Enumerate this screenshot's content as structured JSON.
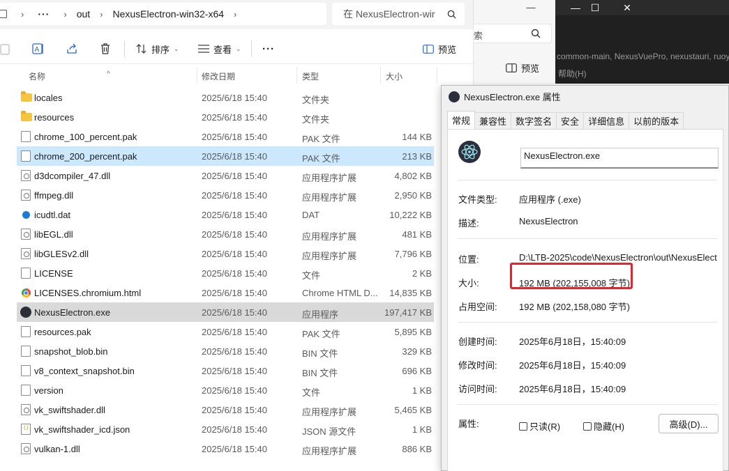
{
  "explorer": {
    "breadcrumb": [
      "out",
      "NexusElectron-win32-x64"
    ],
    "search_placeholder": "在 NexusElectron-wir",
    "toolbar": {
      "sort_label": "排序",
      "view_label": "查看",
      "more_label": "···",
      "preview_label": "预览"
    },
    "columns": {
      "name": "名称",
      "date": "修改日期",
      "type": "类型",
      "size": "大小"
    },
    "files": [
      {
        "name": "locales",
        "date": "2025/6/18 15:40",
        "type": "文件夹",
        "size": "",
        "icon": "folder-icon"
      },
      {
        "name": "resources",
        "date": "2025/6/18 15:40",
        "type": "文件夹",
        "size": "",
        "icon": "folder-icon"
      },
      {
        "name": "chrome_100_percent.pak",
        "date": "2025/6/18 15:40",
        "type": "PAK 文件",
        "size": "144 KB",
        "icon": "file-icon"
      },
      {
        "name": "chrome_200_percent.pak",
        "date": "2025/6/18 15:40",
        "type": "PAK 文件",
        "size": "213 KB",
        "icon": "file-icon"
      },
      {
        "name": "d3dcompiler_47.dll",
        "date": "2025/6/18 15:40",
        "type": "应用程序扩展",
        "size": "4,802 KB",
        "icon": "dll-icon"
      },
      {
        "name": "ffmpeg.dll",
        "date": "2025/6/18 15:40",
        "type": "应用程序扩展",
        "size": "2,950 KB",
        "icon": "dll-icon"
      },
      {
        "name": "icudtl.dat",
        "date": "2025/6/18 15:40",
        "type": "DAT",
        "size": "10,222 KB",
        "icon": "dat-icon"
      },
      {
        "name": "libEGL.dll",
        "date": "2025/6/18 15:40",
        "type": "应用程序扩展",
        "size": "481 KB",
        "icon": "dll-icon"
      },
      {
        "name": "libGLESv2.dll",
        "date": "2025/6/18 15:40",
        "type": "应用程序扩展",
        "size": "7,796 KB",
        "icon": "dll-icon"
      },
      {
        "name": "LICENSE",
        "date": "2025/6/18 15:40",
        "type": "文件",
        "size": "2 KB",
        "icon": "file-icon"
      },
      {
        "name": "LICENSES.chromium.html",
        "date": "2025/6/18 15:40",
        "type": "Chrome HTML D...",
        "size": "14,835 KB",
        "icon": "chrome-icon"
      },
      {
        "name": "NexusElectron.exe",
        "date": "2025/6/18 15:40",
        "type": "应用程序",
        "size": "197,417 KB",
        "icon": "electron-icon"
      },
      {
        "name": "resources.pak",
        "date": "2025/6/18 15:40",
        "type": "PAK 文件",
        "size": "5,895 KB",
        "icon": "file-icon"
      },
      {
        "name": "snapshot_blob.bin",
        "date": "2025/6/18 15:40",
        "type": "BIN 文件",
        "size": "329 KB",
        "icon": "file-icon"
      },
      {
        "name": "v8_context_snapshot.bin",
        "date": "2025/6/18 15:40",
        "type": "BIN 文件",
        "size": "696 KB",
        "icon": "file-icon"
      },
      {
        "name": "version",
        "date": "2025/6/18 15:40",
        "type": "文件",
        "size": "1 KB",
        "icon": "file-icon"
      },
      {
        "name": "vk_swiftshader.dll",
        "date": "2025/6/18 15:40",
        "type": "应用程序扩展",
        "size": "5,465 KB",
        "icon": "dll-icon"
      },
      {
        "name": "vk_swiftshader_icd.json",
        "date": "2025/6/18 15:40",
        "type": "JSON 源文件",
        "size": "1 KB",
        "icon": "json-icon"
      },
      {
        "name": "vulkan-1.dll",
        "date": "2025/6/18 15:40",
        "type": "应用程序扩展",
        "size": "886 KB",
        "icon": "dll-icon"
      }
    ]
  },
  "background": {
    "search_fragment": "索",
    "preview_label": "预览",
    "path_text": "common-main, NexusVuePro, nexustauri, ruoyi",
    "help_text": "帮助(H)"
  },
  "properties": {
    "title": "NexusElectron.exe 属性",
    "tabs": [
      "常规",
      "兼容性",
      "数字签名",
      "安全",
      "详细信息",
      "以前的版本"
    ],
    "filename": "NexusElectron.exe",
    "fields": {
      "type_label": "文件类型:",
      "type_value": "应用程序 (.exe)",
      "desc_label": "描述:",
      "desc_value": "NexusElectron",
      "location_label": "位置:",
      "location_value": "D:\\LTB-2025\\code\\NexusElectron\\out\\NexusElect",
      "size_label": "大小:",
      "size_value": "192 MB (202,155,008 字节)",
      "disk_label": "占用空间:",
      "disk_value": "192 MB (202,158,080 字节)",
      "created_label": "创建时间:",
      "created_value": "2025年6月18日，15:40:09",
      "modified_label": "修改时间:",
      "modified_value": "2025年6月18日，15:40:09",
      "accessed_label": "访问时间:",
      "accessed_value": "2025年6月18日，15:40:09",
      "attr_label": "属性:"
    },
    "readonly_label": "只读(R)",
    "hidden_label": "隐藏(H)",
    "advanced_label": "高级(D)...",
    "highlight_color": "#e0252b"
  }
}
